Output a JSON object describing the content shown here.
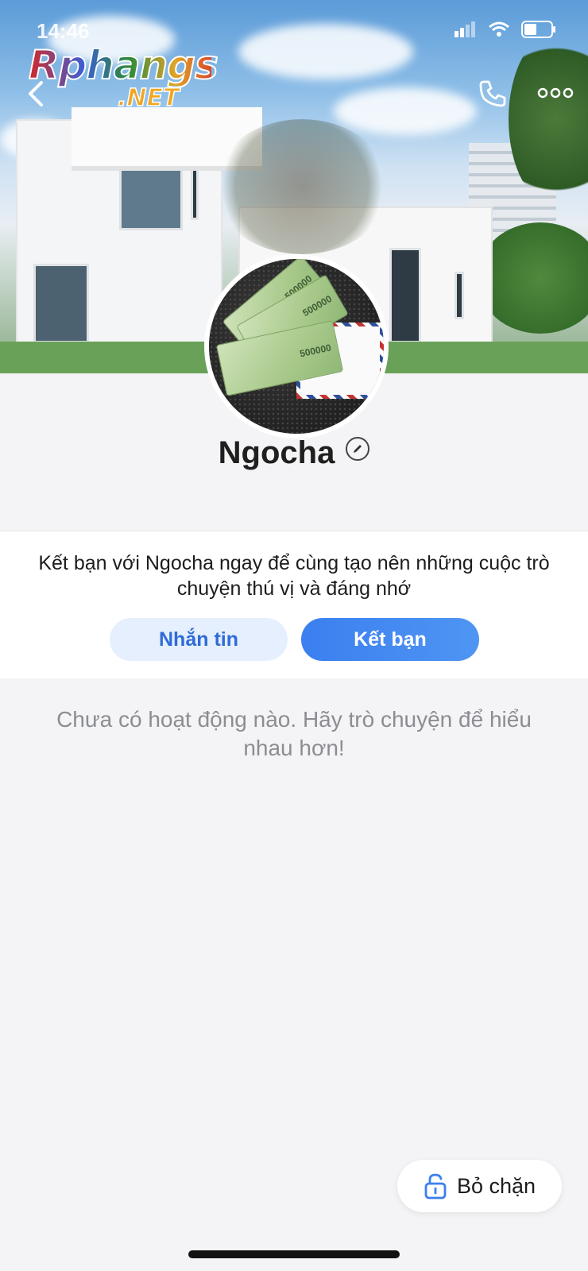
{
  "status_bar": {
    "time": "14:46"
  },
  "watermark": {
    "line1": "Rphangs",
    "line2": ".NET"
  },
  "header": {
    "back_icon": "chevron-left-icon",
    "call_icon": "phone-icon",
    "more_icon": "more-horizontal-icon"
  },
  "avatar": {
    "banknote_text": "500000"
  },
  "profile": {
    "name": "Ngocha",
    "edit_icon": "pencil-icon"
  },
  "invite": {
    "text": "Kết bạn với Ngocha ngay để cùng tạo nên những cuộc trò chuyện thú vị và đáng nhớ",
    "message_button": "Nhắn tin",
    "add_friend_button": "Kết bạn"
  },
  "activity": {
    "empty_text": "Chưa có hoạt động nào. Hãy trò chuyện để hiểu nhau hơn!"
  },
  "unblock": {
    "icon": "unlock-icon",
    "label": "Bỏ chặn"
  },
  "colors": {
    "accent": "#3b7ff0",
    "secondary_button_bg": "#e5effd",
    "page_bg": "#f4f4f6"
  }
}
